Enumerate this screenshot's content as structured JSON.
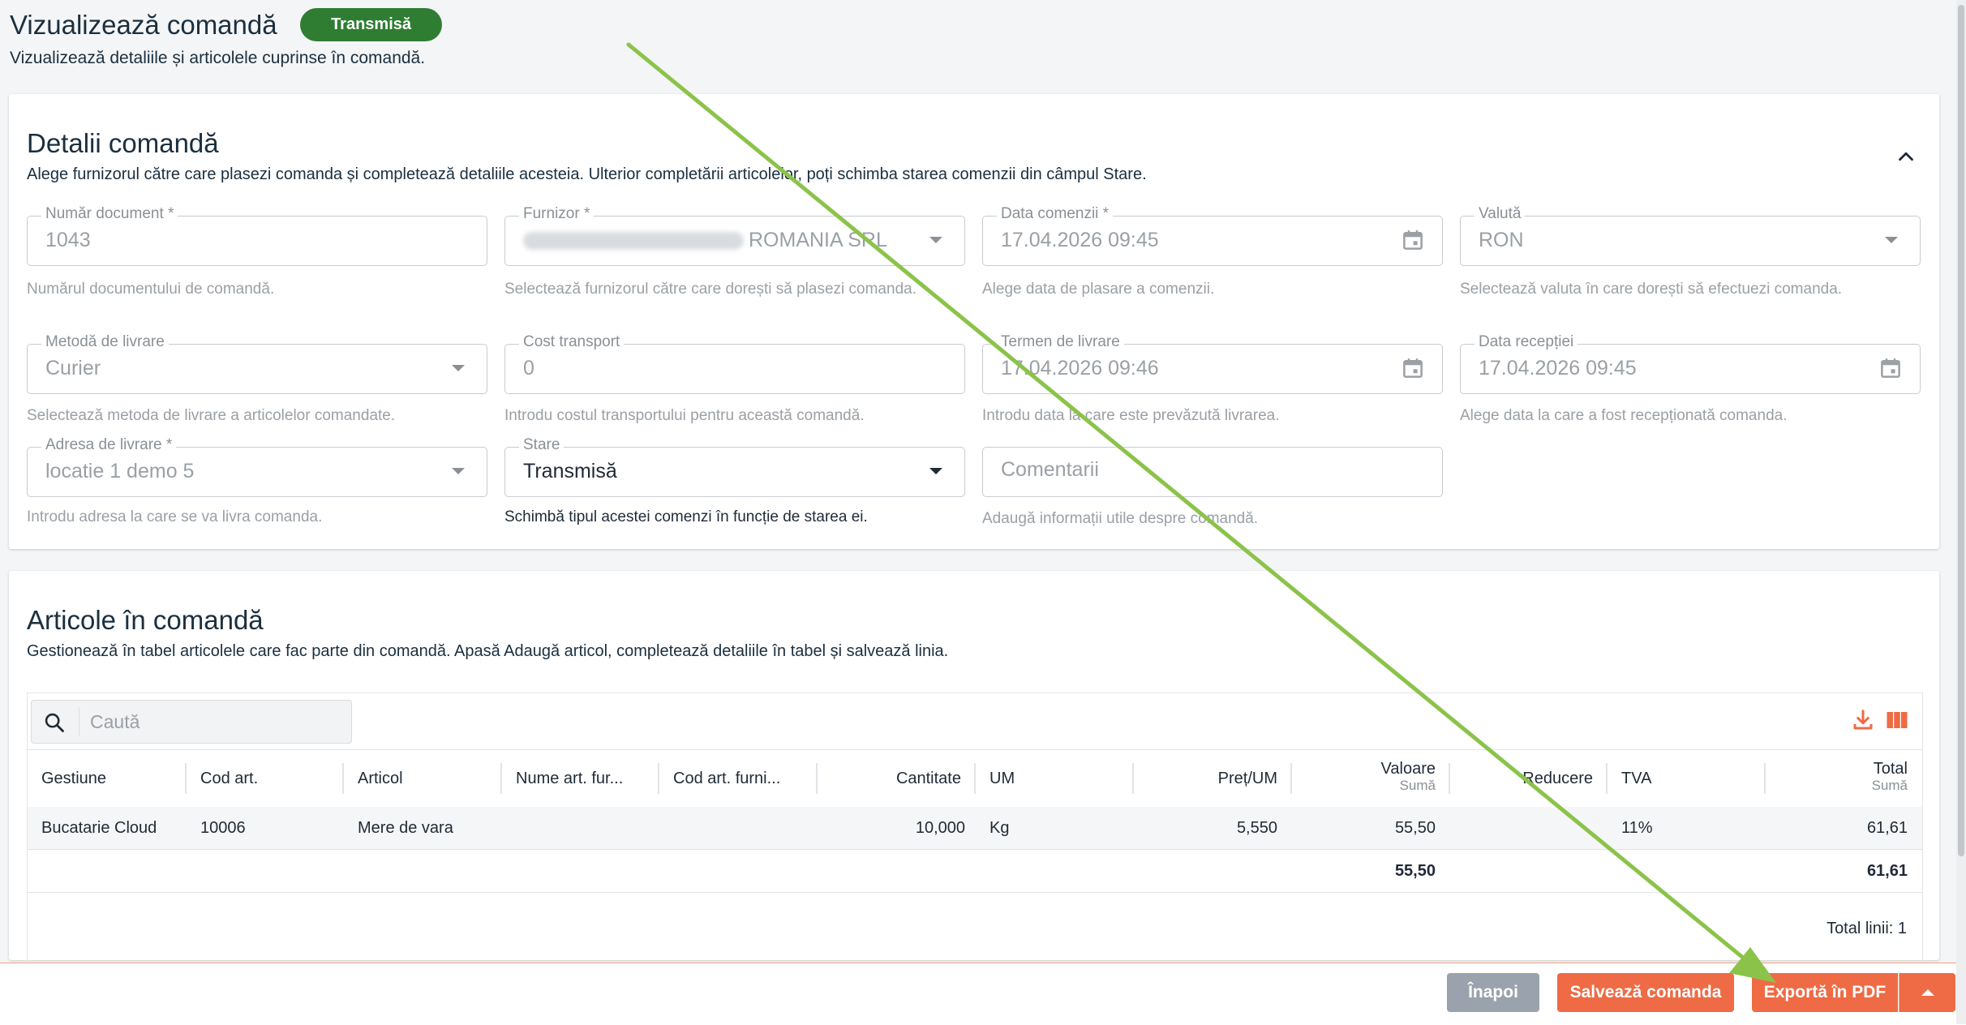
{
  "header": {
    "title": "Vizualizează comandă",
    "status": "Transmisă",
    "subtitle": "Vizualizează detaliile și articolele cuprinse în comandă."
  },
  "details": {
    "title": "Detalii comandă",
    "description": "Alege furnizorul către care plasezi comanda și completează detaliile acesteia. Ulterior completării articolelor, poți schimba starea comenzii din câmpul Stare.",
    "fields": {
      "document_number": {
        "label": "Număr document *",
        "value": "1043",
        "helper": "Numărul documentului de comandă."
      },
      "supplier": {
        "label": "Furnizor *",
        "value": "ROMANIA SRL",
        "helper": "Selectează furnizorul către care dorești să plasezi comanda."
      },
      "order_date": {
        "label": "Data comenzii *",
        "value": "17.04.2026 09:45",
        "helper": "Alege data de plasare a comenzii."
      },
      "currency": {
        "label": "Valută",
        "value": "RON",
        "helper": "Selectează valuta în care dorești să efectuezi comanda."
      },
      "delivery_method": {
        "label": "Metodă de livrare",
        "value": "Curier",
        "helper": "Selectează metoda de livrare a articolelor comandate."
      },
      "transport_cost": {
        "label": "Cost transport",
        "value": "0",
        "helper": "Introdu costul transportului pentru această comandă."
      },
      "delivery_term": {
        "label": "Termen de livrare",
        "value": "17.04.2026 09:46",
        "helper": "Introdu data la care este prevăzută livrarea."
      },
      "reception_date": {
        "label": "Data recepției",
        "value": "17.04.2026 09:45",
        "helper": "Alege data la care a fost recepționată comanda."
      },
      "delivery_address": {
        "label": "Adresa de livrare *",
        "value": "locatie 1 demo 5",
        "helper": "Introdu adresa la care se va livra comanda."
      },
      "state": {
        "label": "Stare",
        "value": "Transmisă",
        "helper": "Schimbă tipul acestei comenzi în funcție de starea ei."
      },
      "comments": {
        "placeholder": "Comentarii",
        "helper": "Adaugă informații utile despre comandă."
      }
    }
  },
  "items": {
    "title": "Articole în comandă",
    "description": "Gestionează în tabel articolele care fac parte din comandă. Apasă Adaugă articol, completează detaliile în tabel și salvează linia.",
    "search_placeholder": "Caută",
    "columns": {
      "gestiune": "Gestiune",
      "cod_art": "Cod art.",
      "articol": "Articol",
      "nume_art_furn": "Nume art. fur...",
      "cod_art_furn": "Cod art. furni...",
      "cantitate": "Cantitate",
      "um": "UM",
      "pret_um": "Preț/UM",
      "valoare": "Valoare",
      "valoare_sub": "Sumă",
      "reducere": "Reducere",
      "tva": "TVA",
      "total": "Total",
      "total_sub": "Sumă"
    },
    "rows": [
      {
        "gestiune": "Bucatarie Cloud",
        "cod_art": "10006",
        "articol": "Mere de vara",
        "nume_art_furn": "",
        "cod_art_furn": "",
        "cantitate": "10,000",
        "um": "Kg",
        "pret_um": "5,550",
        "valoare": "55,50",
        "reducere": "",
        "tva": "11%",
        "total": "61,61"
      }
    ],
    "totals": {
      "valoare": "55,50",
      "total": "61,61"
    },
    "total_lines": "Total linii: 1"
  },
  "footer": {
    "back": "Înapoi",
    "save": "Salvează comanda",
    "export": "Exportă în PDF"
  },
  "colors": {
    "accent": "#ee6b45",
    "status_badge": "#2f7d32",
    "back_button": "#9aa3ad",
    "annotation_arrow": "#8bc34a"
  },
  "icons": {
    "collapse": "chevron-up-icon",
    "calendar": "calendar-icon",
    "search": "search-icon",
    "download": "download-icon",
    "columns": "columns-icon"
  }
}
